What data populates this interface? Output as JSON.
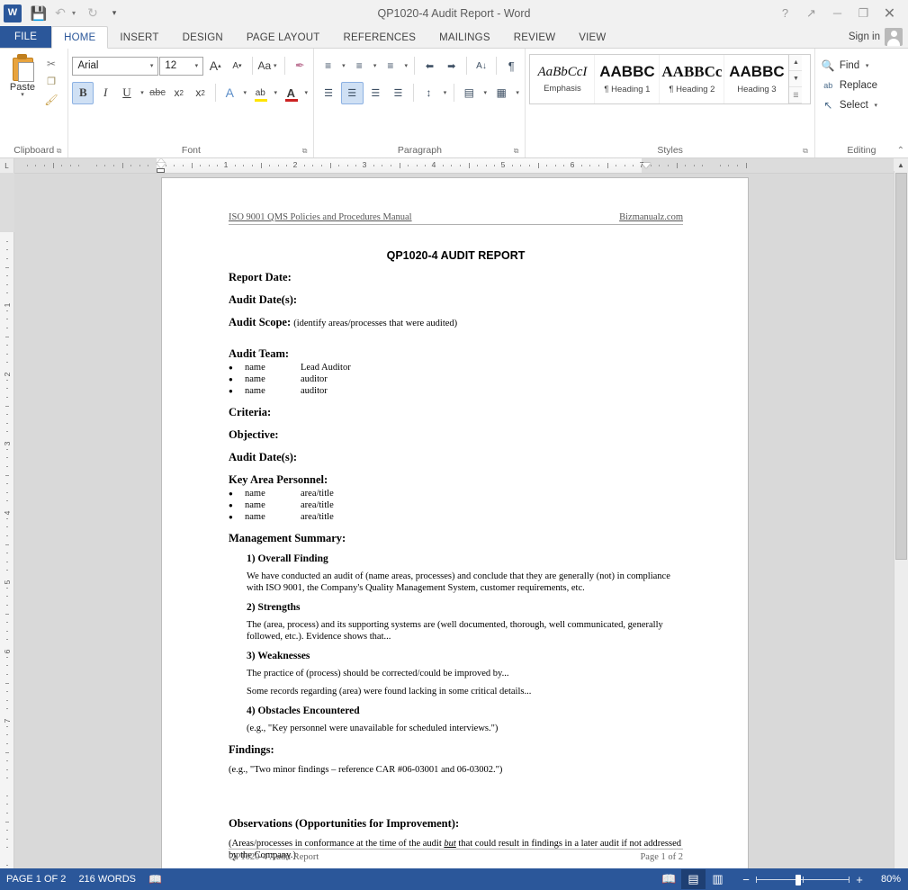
{
  "window": {
    "title": "QP1020-4 Audit Report - Word",
    "logo_text": "W",
    "quick_access": [
      {
        "name": "save",
        "glyph": "💾"
      },
      {
        "name": "undo",
        "glyph": "↶"
      },
      {
        "name": "redo",
        "glyph": "↻"
      },
      {
        "name": "customize",
        "glyph": "▾"
      }
    ],
    "controls": [
      {
        "name": "help",
        "glyph": "?"
      },
      {
        "name": "ribbon-display-options",
        "glyph": "↗"
      },
      {
        "name": "minimize",
        "glyph": "─"
      },
      {
        "name": "restore",
        "glyph": "❐"
      },
      {
        "name": "close",
        "glyph": "✕"
      }
    ]
  },
  "tabs": {
    "file": "FILE",
    "items": [
      "HOME",
      "INSERT",
      "DESIGN",
      "PAGE LAYOUT",
      "REFERENCES",
      "MAILINGS",
      "REVIEW",
      "VIEW"
    ],
    "active": "HOME",
    "sign_in": "Sign in"
  },
  "ribbon": {
    "clipboard": {
      "label": "Clipboard",
      "paste_label": "Paste",
      "paste_caret": "▾",
      "cut": "✂",
      "copy": "❐",
      "format_painter": "🖌"
    },
    "font": {
      "label": "Font",
      "family_value": "Arial",
      "size_value": "12",
      "grow_font": "A",
      "shrink_font": "A",
      "change_case": "Aa",
      "clear_formatting": "✒",
      "bold": "B",
      "italic": "I",
      "underline": "U",
      "strikethrough": "abc",
      "subscript": "x",
      "superscript": "x",
      "text_effects": "A",
      "highlight": "ab",
      "font_color": "A",
      "caret": "▾"
    },
    "paragraph": {
      "label": "Paragraph",
      "bullets": "≡",
      "numbering": "≡",
      "multilevel": "≡",
      "decrease_indent": "⬅",
      "increase_indent": "➡",
      "sort": "A↓",
      "show_marks": "¶",
      "align_left": "☰",
      "align_center": "☰",
      "align_right": "☰",
      "justify": "☰",
      "line_spacing": "↕",
      "shading": "▤",
      "borders": "▦",
      "caret": "▾"
    },
    "styles": {
      "label": "Styles",
      "items": [
        {
          "preview": "AaBbCcI",
          "name": "Emphasis",
          "cls": "emph"
        },
        {
          "preview": "AABBC",
          "name": "¶ Heading 1",
          "cls": "h1"
        },
        {
          "preview": "AABBCс",
          "name": "¶ Heading 2",
          "cls": "h2"
        },
        {
          "preview": "AABBC",
          "name": "Heading 3",
          "cls": "h3"
        }
      ],
      "scroll_up": "▲",
      "scroll_down": "▼",
      "more": "☰"
    },
    "editing": {
      "label": "Editing",
      "find": "Find",
      "replace": "Replace",
      "select": "Select",
      "find_icon": "🔍",
      "replace_icon": "ab",
      "select_icon": "↖",
      "caret": "▾"
    },
    "collapse_glyph": "⌃"
  },
  "ruler": {
    "corner_glyph": "L",
    "h_numbers": [
      "1",
      "2",
      "3",
      "4",
      "5",
      "6",
      "7"
    ],
    "v_numbers": [
      "1",
      "2",
      "3",
      "4",
      "5",
      "6",
      "7"
    ]
  },
  "document": {
    "header_left": "ISO 9001 QMS Policies and Procedures Manual",
    "header_right": "Bizmanualz.com",
    "title": "QP1020-4 AUDIT REPORT",
    "fields": [
      {
        "label": "Report Date:",
        "hint": ""
      },
      {
        "label": "Audit Date(s):",
        "hint": ""
      },
      {
        "label": "Audit Scope:",
        "hint": "(identify areas/processes that were audited)"
      }
    ],
    "audit_team_label": "Audit Team:",
    "audit_team": [
      {
        "name": "name",
        "role": "Lead Auditor"
      },
      {
        "name": "name",
        "role": "auditor"
      },
      {
        "name": "name",
        "role": "auditor"
      }
    ],
    "fields2": [
      {
        "label": "Criteria:",
        "hint": ""
      },
      {
        "label": "Objective:",
        "hint": ""
      },
      {
        "label": "Audit Date(s):",
        "hint": ""
      }
    ],
    "key_personnel_label": "Key Area Personnel:",
    "key_personnel": [
      {
        "name": "name",
        "role": "area/title"
      },
      {
        "name": "name",
        "role": "area/title"
      },
      {
        "name": "name",
        "role": "area/title"
      }
    ],
    "management_summary_label": "Management Summary:",
    "summary_sections": [
      {
        "heading": "1) Overall Finding",
        "paragraphs": [
          "We have conducted an audit of (name areas, processes) and conclude that they are generally (not) in compliance with ISO 9001, the Company's Quality Management System, customer requirements, etc."
        ]
      },
      {
        "heading": "2) Strengths",
        "paragraphs": [
          "The (area, process) and its supporting systems are (well documented, thorough, well communicated, generally followed, etc.).  Evidence shows that..."
        ]
      },
      {
        "heading": "3) Weaknesses",
        "paragraphs": [
          "The practice of (process) should be corrected/could be improved by...",
          "Some records regarding (area) were found lacking in some critical details..."
        ]
      },
      {
        "heading": "4) Obstacles Encountered",
        "paragraphs": [
          "(e.g., \"Key personnel were unavailable for scheduled interviews.\")"
        ]
      }
    ],
    "findings_label": "Findings:",
    "findings_text": "(e.g., \"Two minor findings – reference CAR #06-03001 and 06-03002.\")",
    "observations_label": "Observations (Opportunities for Improvement):",
    "observations_pre": "(Areas/processes in conformance at the time of the audit ",
    "observations_em": "but",
    "observations_post": " that could result in findings in a later audit if not addressed by the Company.)",
    "footer_left": "QP1020-4 Audit Report",
    "footer_right": "Page 1 of 2"
  },
  "statusbar": {
    "page_info": "PAGE 1 OF 2",
    "word_count": "216 WORDS",
    "proofing_icon": "📖",
    "views": [
      {
        "name": "read-mode",
        "glyph": "📖",
        "active": false
      },
      {
        "name": "print-layout",
        "glyph": "▤",
        "active": true
      },
      {
        "name": "web-layout",
        "glyph": "▥",
        "active": false
      }
    ],
    "zoom_minus": "−",
    "zoom_plus": "+",
    "zoom_value": "80%"
  },
  "colors": {
    "accent": "#2b579a",
    "ribbon_bg": "#ffffff",
    "chrome_bg": "#f1f1f1",
    "canvas_bg": "#d9d9d9",
    "page_bg": "#ffffff"
  }
}
